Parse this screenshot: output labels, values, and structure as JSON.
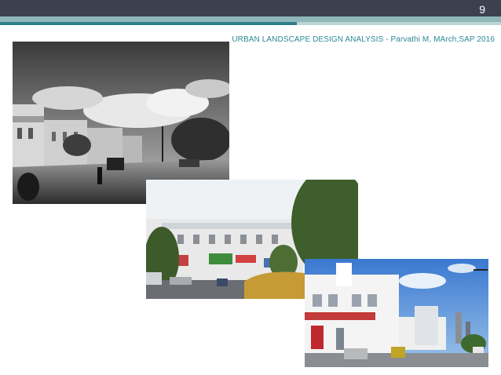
{
  "slide": {
    "number": "9",
    "header": "URBAN LANDSCAPE DESIGN ANALYSIS - Parvathi M, MArch,SAP 2016"
  },
  "photos": [
    {
      "name": "historic-street-photo",
      "style": "black-and-white"
    },
    {
      "name": "market-street-photo",
      "style": "color"
    },
    {
      "name": "white-colonnade-street-photo",
      "style": "color"
    }
  ],
  "colors": {
    "top_bar": "#3c4150",
    "stripe_light": "#8fb7b9",
    "stripe_dark": "#2e7f8a",
    "header_text": "#2a8a96"
  }
}
